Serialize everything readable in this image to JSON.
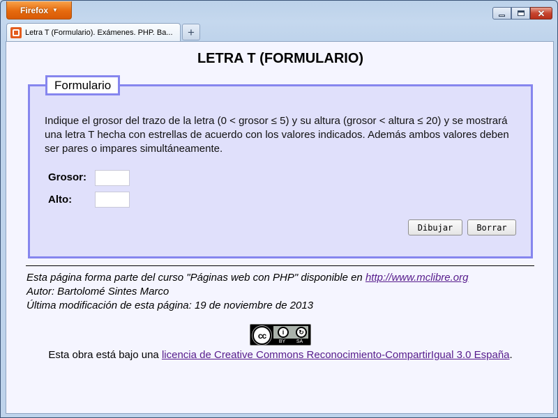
{
  "browser": {
    "app_button_label": "Firefox",
    "tab_title": "Letra T (Formulario). Exámenes. PHP. Ba...",
    "new_tab_label": "+"
  },
  "page": {
    "title": "LETRA T (FORMULARIO)",
    "form": {
      "legend": "Formulario",
      "description": "Indique el grosor del trazo de la letra (0 < grosor ≤ 5) y su altura (grosor < altura ≤ 20) y se mostrará una letra T hecha con estrellas de acuerdo con los valores indicados. Además ambos valores deben ser pares o impares simultáneamente.",
      "grosor_label": "Grosor:",
      "grosor_value": "",
      "alto_label": "Alto:",
      "alto_value": "",
      "draw_button": "Dibujar",
      "clear_button": "Borrar"
    },
    "footer": {
      "course_text": "Esta página forma parte del curso \"Páginas web con PHP\" disponible en ",
      "course_link": "http://www.mclibre.org",
      "author": "Autor: Bartolomé Sintes Marco",
      "modified": "Última modificación de esta página: 19 de noviembre de 2013",
      "license_prefix": "Esta obra está bajo una ",
      "license_link": "licencia de Creative Commons Reconocimiento-CompartirIgual 3.0 España",
      "license_suffix": ".",
      "cc_badge": {
        "cc": "cc",
        "by": "BY",
        "sa": "SA"
      }
    }
  },
  "colors": {
    "fieldset_border": "#8686ee",
    "fieldset_bg": "#e0e0fb",
    "page_bg": "#f5f5ff",
    "visited_link": "#551a8b",
    "firefox_orange": "#e66a0e"
  }
}
